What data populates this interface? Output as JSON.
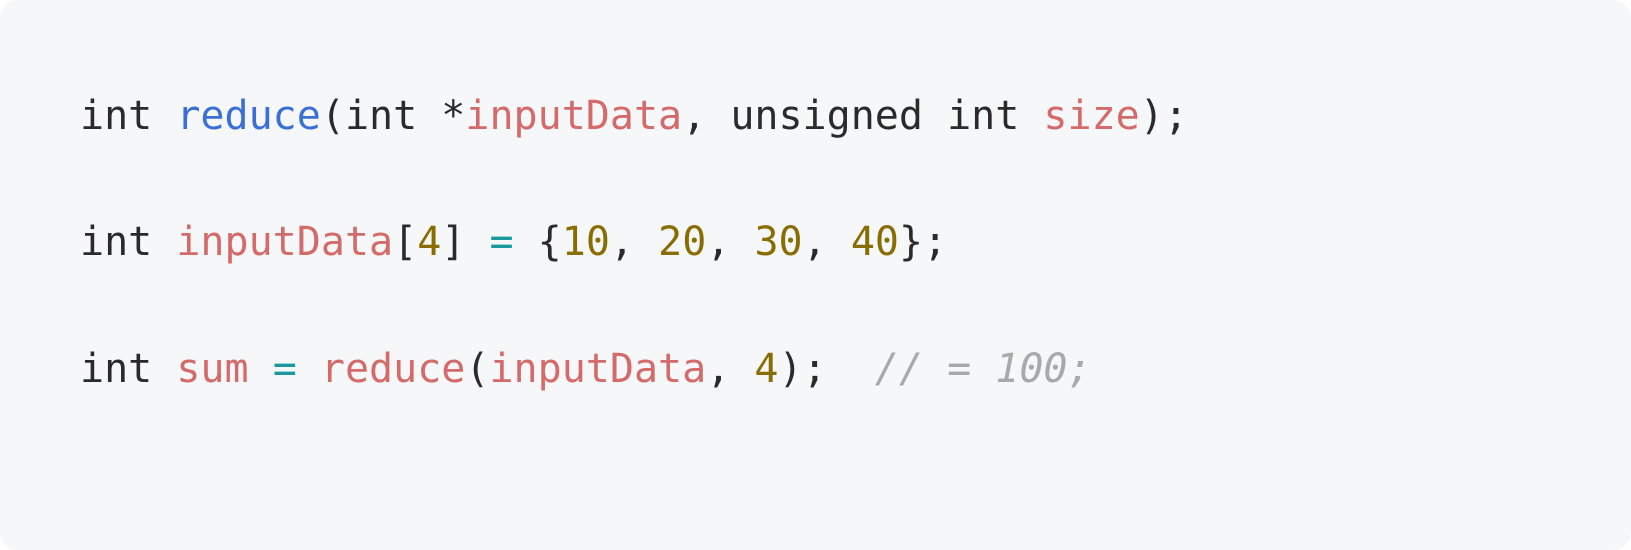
{
  "code": {
    "line1": {
      "t_int1": "int",
      "sp1": " ",
      "fn": "reduce",
      "p_open": "(",
      "t_int2": "int",
      "sp2": " ",
      "star": "*",
      "param1": "inputData",
      "comma1": ",",
      "sp3": " ",
      "t_unsigned": "unsigned",
      "sp4": " ",
      "t_int3": "int",
      "sp5": " ",
      "param2": "size",
      "p_close": ")",
      "semi": ";"
    },
    "line3": {
      "t_int": "int",
      "sp1": " ",
      "var": "inputData",
      "br_open": "[",
      "arr_size": "4",
      "br_close": "]",
      "sp2": " ",
      "eq": "=",
      "sp3": " ",
      "cb_open": "{",
      "v1": "10",
      "c1": ",",
      "sp4": " ",
      "v2": "20",
      "c2": ",",
      "sp5": " ",
      "v3": "30",
      "c3": ",",
      "sp6": " ",
      "v4": "40",
      "cb_close": "}",
      "semi": ";"
    },
    "line5": {
      "t_int": "int",
      "sp1": " ",
      "var": "sum",
      "sp2": " ",
      "eq": "=",
      "sp3": " ",
      "fn": "reduce",
      "p_open": "(",
      "arg1": "inputData",
      "c1": ",",
      "sp4": " ",
      "arg2": "4",
      "p_close": ")",
      "semi": ";",
      "sp5": "  ",
      "comment": "// = 100;"
    }
  }
}
